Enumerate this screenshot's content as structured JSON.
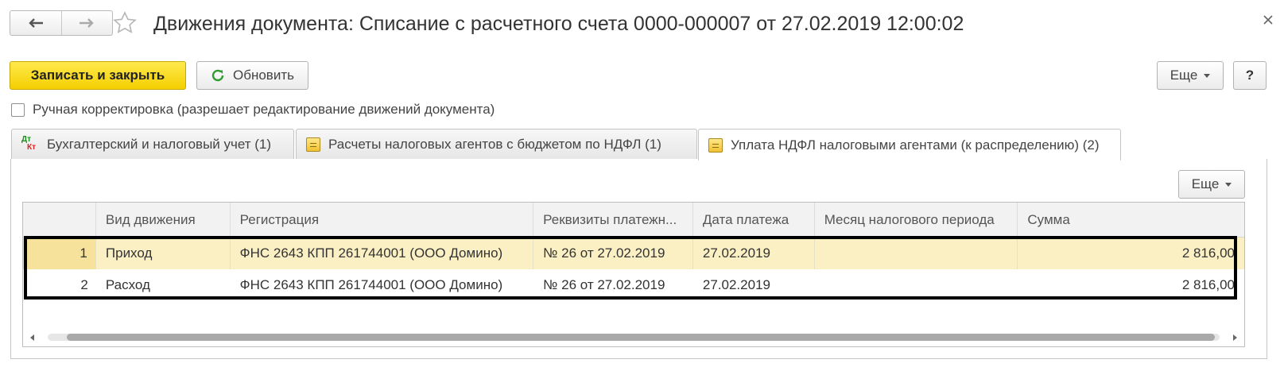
{
  "window": {
    "title": "Движения документа: Списание с расчетного счета 0000-000007 от 27.02.2019 12:00:02",
    "close_icon": "close-icon"
  },
  "toolbar": {
    "save_close_label": "Записать и закрыть",
    "refresh_label": "Обновить",
    "more_label": "Еще",
    "help_label": "?"
  },
  "manual_edit": {
    "label": "Ручная корректировка (разрешает редактирование движений документа)",
    "checked": false
  },
  "tabs": [
    {
      "label": "Бухгалтерский и налоговый учет (1)",
      "icon": "dt-kt-icon",
      "active": false
    },
    {
      "label": "Расчеты налоговых агентов с бюджетом по НДФЛ (1)",
      "icon": "register-icon",
      "active": false
    },
    {
      "label": "Уплата НДФЛ налоговыми агентами (к распределению) (2)",
      "icon": "register-icon",
      "active": true
    }
  ],
  "panel": {
    "more_label": "Еще"
  },
  "table": {
    "columns": [
      "",
      "Вид движения",
      "Регистрация",
      "Реквизиты платежн...",
      "Дата платежа",
      "Месяц налогового периода",
      "Сумма"
    ],
    "rows": [
      {
        "n": "1",
        "kind": "Приход",
        "registration": "ФНС 2643 КПП 261744001 (ООО Домино)",
        "payment_details": "№ 26 от 27.02.2019",
        "payment_date": "27.02.2019",
        "tax_month": "",
        "amount": "2 816,00"
      },
      {
        "n": "2",
        "kind": "Расход",
        "registration": "ФНС 2643 КПП 261744001 (ООО Домино)",
        "payment_details": "№ 26 от 27.02.2019",
        "payment_date": "27.02.2019",
        "tax_month": "",
        "amount": "2 816,00"
      }
    ],
    "selected_row": 1
  },
  "colors": {
    "primary_button": "#f4cf00",
    "selected_row": "#fbf0c4",
    "highlight_border": "#000000"
  }
}
